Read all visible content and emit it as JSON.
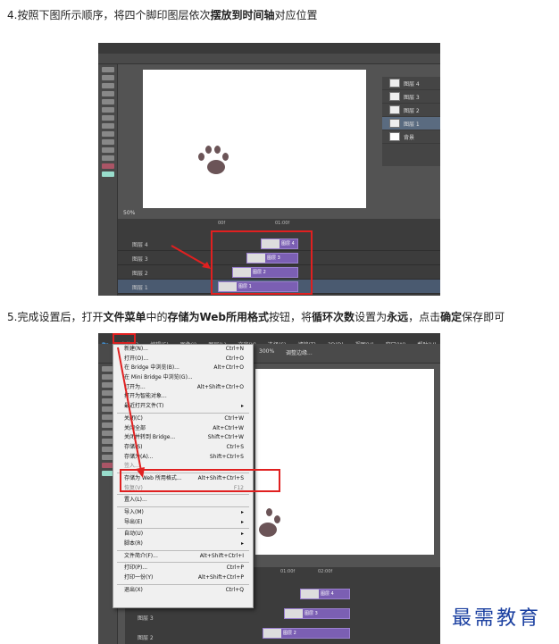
{
  "step4": {
    "prefix": "4.按照下图所示顺序，将四个脚印图层依次",
    "bold1": "摆放到",
    "bold2": "时间轴",
    "suffix": "对应位置"
  },
  "step5": {
    "p1": "5.完成设置后，打开",
    "b1": "文件菜单",
    "p2": "中的",
    "b2": "存储为Web所用格式",
    "p3": "按钮，将",
    "b3": "循环次数",
    "p4": "设置为",
    "b4": "永远",
    "p5": "，点击",
    "b5": "确定",
    "p6": "保存即可"
  },
  "ps1": {
    "zoom": "50%",
    "time_marks": [
      "00f",
      "01:00f"
    ],
    "layers": [
      "图层 4",
      "图层 3",
      "图层 2",
      "图层 1",
      "背景"
    ],
    "timeline_rows": [
      "图层 4",
      "图层 3",
      "图层 2",
      "图层 1"
    ],
    "clips": [
      "图层 4",
      "图层 3",
      "图层 2",
      "图层 1"
    ]
  },
  "ps2": {
    "logo": "Ps",
    "menubar": [
      "文件(F)",
      "编辑(E)",
      "图像(I)",
      "图层(L)",
      "文字(Y)",
      "选择(S)",
      "滤镜(T)",
      "3D(D)",
      "视图(V)",
      "窗口(W)",
      "帮助(H)"
    ],
    "zoom": "300%",
    "option_text": "调整边缘...",
    "file_menu": [
      {
        "label": "新建(N)...",
        "shortcut": "Ctrl+N"
      },
      {
        "label": "打开(O)...",
        "shortcut": "Ctrl+O"
      },
      {
        "label": "在 Bridge 中浏览(B)...",
        "shortcut": "Alt+Ctrl+O"
      },
      {
        "label": "在 Mini Bridge 中浏览(G)...",
        "shortcut": ""
      },
      {
        "label": "打开为...",
        "shortcut": "Alt+Shift+Ctrl+O"
      },
      {
        "label": "打开为智能对象...",
        "shortcut": ""
      },
      {
        "label": "最近打开文件(T)",
        "shortcut": "▸"
      },
      {
        "label": "关闭(C)",
        "shortcut": "Ctrl+W"
      },
      {
        "label": "关闭全部",
        "shortcut": "Alt+Ctrl+W"
      },
      {
        "label": "关闭并转到 Bridge...",
        "shortcut": "Shift+Ctrl+W"
      },
      {
        "label": "存储(S)",
        "shortcut": "Ctrl+S"
      },
      {
        "label": "存储为(A)...",
        "shortcut": "Shift+Ctrl+S"
      },
      {
        "label": "签入...",
        "shortcut": ""
      },
      {
        "label": "存储为 Web 所用格式...",
        "shortcut": "Alt+Shift+Ctrl+S"
      },
      {
        "label": "恢复(V)",
        "shortcut": "F12"
      },
      {
        "label": "置入(L)...",
        "shortcut": ""
      },
      {
        "label": "导入(M)",
        "shortcut": "▸"
      },
      {
        "label": "导出(E)",
        "shortcut": "▸"
      },
      {
        "label": "自动(U)",
        "shortcut": "▸"
      },
      {
        "label": "脚本(R)",
        "shortcut": "▸"
      },
      {
        "label": "文件简介(F)...",
        "shortcut": "Alt+Shift+Ctrl+I"
      },
      {
        "label": "打印(P)...",
        "shortcut": "Ctrl+P"
      },
      {
        "label": "打印一份(Y)",
        "shortcut": "Alt+Shift+Ctrl+P"
      },
      {
        "label": "退出(X)",
        "shortcut": "Ctrl+Q"
      }
    ],
    "time_marks": [
      "01:00f",
      "02:00f"
    ],
    "timeline_rows": [
      "图层 3",
      "图层 2"
    ],
    "clips": [
      "图层 4",
      "图层 3",
      "图层 2"
    ]
  },
  "watermark": "最需教育",
  "colors": {
    "accent_red": "#e02020",
    "clip_purple": "#7b5fb3",
    "paw": "#6b5457"
  }
}
